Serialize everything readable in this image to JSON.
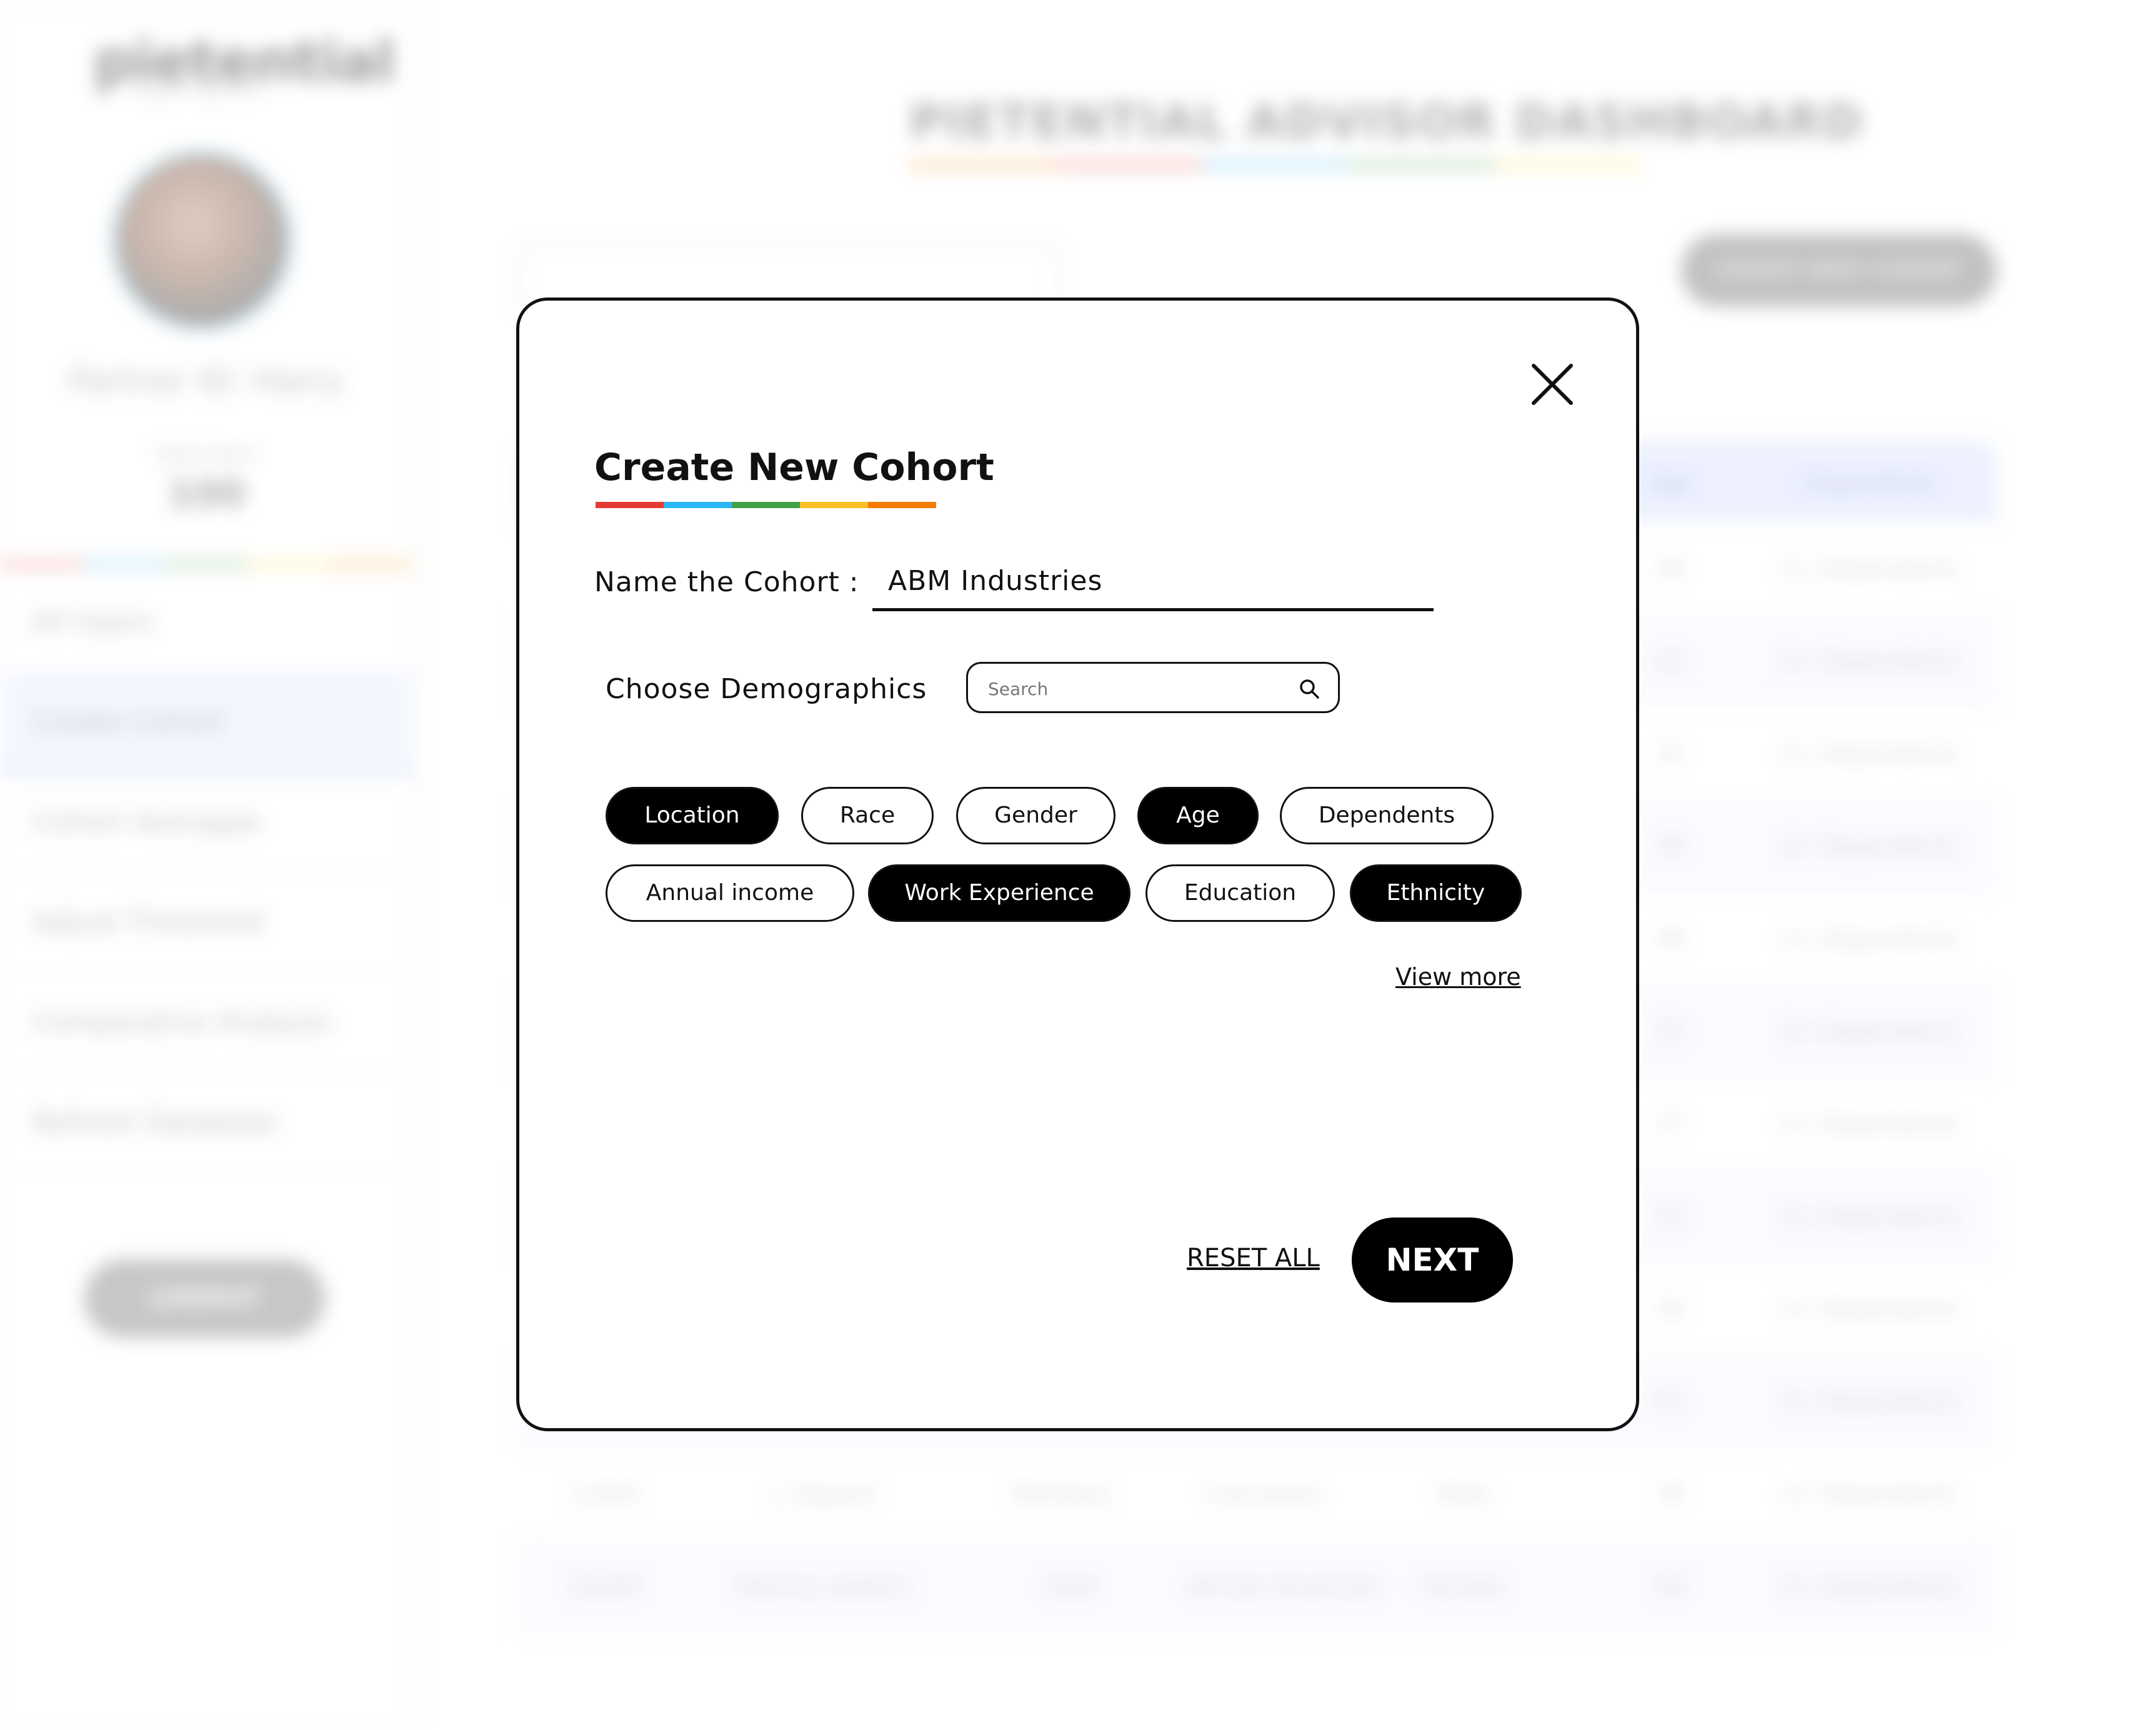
{
  "background": {
    "logo": "pietential",
    "logo_sub": "SMART WEALTH",
    "partner_name": "Partner ID: Harry",
    "total_users_label": "Total Users",
    "total_users_value": "100",
    "nav": [
      "All Users",
      "Create Cohort",
      "Cohort Averages",
      "Adjust Threshold",
      "Comparative Analysis",
      "Refresh Database"
    ],
    "logout_label": "LOGOUT",
    "dashboard_title": "PIETENTIAL ADVISOR DASHBOARD",
    "create_button_label": "CREATE NEW COHORT",
    "table_headers": [
      "Age",
      "Dependents"
    ],
    "table_rows": [
      {
        "age": "29",
        "dependents": "2+ Dependents"
      },
      {
        "age": "42",
        "dependents": "2+ Dependents"
      },
      {
        "age": "32",
        "dependents": "2+ Dependents"
      },
      {
        "age": "39",
        "dependents": "2+ Dependents"
      },
      {
        "age": "48",
        "dependents": "2+ Dependents"
      },
      {
        "age": "35",
        "dependents": "2+ Dependents"
      },
      {
        "age": "27",
        "dependents": "2+ Dependents"
      },
      {
        "age": "33",
        "dependents": "2+ Dependents"
      },
      {
        "age": "56",
        "dependents": "2+ Dependents"
      },
      {
        "age": "41",
        "dependents": "2+ Dependents"
      }
    ],
    "extra_rows": [
      {
        "id": "11492",
        "name": "J. Eppard",
        "state": "Montana",
        "race": "Caucasian",
        "gender": "Male",
        "age": "39",
        "dependents": "2+ Dependents"
      },
      {
        "id": "35204",
        "name": "Patricia walters",
        "state": "Utah",
        "race": "African American",
        "gender": "Female",
        "age": "59",
        "dependents": "2+ Dependents"
      }
    ]
  },
  "modal": {
    "title": "Create New Cohort",
    "name_label": "Name the Cohort :",
    "name_value": "ABM Industries",
    "demographics_label": "Choose Demographics",
    "search_placeholder": "Search",
    "chips": [
      {
        "label": "Location",
        "selected": true
      },
      {
        "label": "Race",
        "selected": false
      },
      {
        "label": "Gender",
        "selected": false
      },
      {
        "label": "Age",
        "selected": true
      },
      {
        "label": "Dependents",
        "selected": false
      },
      {
        "label": "Annual income",
        "selected": false
      },
      {
        "label": "Work Experience",
        "selected": true
      },
      {
        "label": "Education",
        "selected": false
      },
      {
        "label": "Ethnicity",
        "selected": true
      }
    ],
    "view_more": "View more",
    "reset_all": "RESET ALL",
    "next": "NEXT"
  },
  "colors": {
    "rainbow": [
      "#e53935",
      "#29b6f6",
      "#43a047",
      "#fbbf24",
      "#f57c00"
    ],
    "selected_chip": "#000000",
    "primary_button": "#000000"
  },
  "icons": {
    "close": "close-icon",
    "search": "search-icon"
  }
}
